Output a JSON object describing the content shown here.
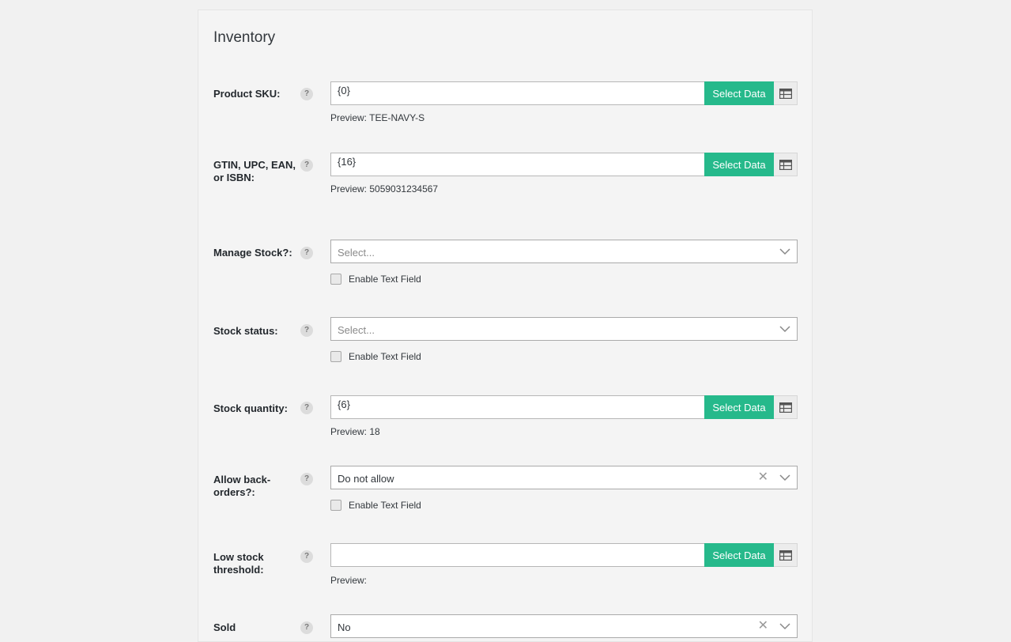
{
  "section": {
    "title": "Inventory"
  },
  "help_glyph": "?",
  "select_data_label": "Select Data",
  "enable_text_field_label": "Enable Text Field",
  "fields": {
    "product_sku": {
      "label": "Product SKU:",
      "value": "{0}",
      "preview": "Preview: TEE-NAVY-S"
    },
    "gtin": {
      "label": "GTIN, UPC, EAN, or ISBN:",
      "value": "{16}",
      "preview": "Preview: 5059031234567"
    },
    "manage_stock": {
      "label": "Manage Stock?:",
      "placeholder": "Select..."
    },
    "stock_status": {
      "label": "Stock status:",
      "placeholder": "Select..."
    },
    "stock_quantity": {
      "label": "Stock quantity:",
      "value": "{6}",
      "preview": "Preview: 18"
    },
    "allow_backorders": {
      "label": "Allow back-orders?:",
      "selected": "Do not allow"
    },
    "low_stock_threshold": {
      "label": "Low stock threshold:",
      "value": "",
      "preview": "Preview:"
    },
    "sold_individually": {
      "label": "Sold",
      "selected": "No"
    }
  },
  "colors": {
    "accent_button": "#26b98b",
    "panel_bg": "#f4f4f4",
    "page_bg": "#f1f1f1"
  },
  "icons": {
    "help": "help-icon",
    "table": "table-icon",
    "chevron": "chevron-down-icon",
    "clear": "clear-icon"
  }
}
